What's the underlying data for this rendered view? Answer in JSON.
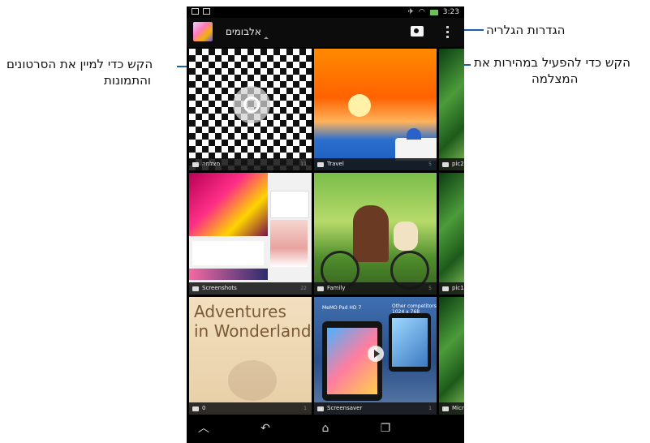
{
  "callouts": {
    "gallery_settings": "הגדרות הגלריה",
    "sort_line1": "הקש כדי למיין את הסרטונים",
    "sort_line2": "והתמונות",
    "camera_line1": "הקש כדי להפעיל במהירות את",
    "camera_line2": "המצלמה"
  },
  "status_bar": {
    "time": "3:23"
  },
  "action_bar": {
    "album_label": "אלבומים"
  },
  "tiles": [
    {
      "caption": "מצלמה",
      "count": "11"
    },
    {
      "caption": "Travel",
      "count": "5"
    },
    {
      "caption": "pic2",
      "count": ""
    },
    {
      "caption": "Screenshots",
      "count": "22"
    },
    {
      "caption": "Family",
      "count": "5"
    },
    {
      "caption": "pic1",
      "count": ""
    },
    {
      "caption": "0",
      "count": "1"
    },
    {
      "caption": "Screensaver",
      "count": "1"
    },
    {
      "caption": "Micr",
      "count": ""
    }
  ],
  "tile_art": {
    "book_title_line1": "Adventures",
    "book_title_line2": "in Wonderland",
    "screensaver_left": "MeMO Pad HD 7",
    "screensaver_right_line1": "Other competitors",
    "screensaver_right_line2": "1024 x 768"
  },
  "colors": {
    "callout_line": "#1a5fb4",
    "action_bar_bg": "#0c0c0c",
    "battery": "#6ec05a"
  },
  "icons": {
    "back": "back-icon",
    "home": "home-icon",
    "recents": "recents-icon",
    "collapse": "collapse-icon",
    "camera": "camera-icon",
    "overflow": "overflow-menu-icon"
  }
}
